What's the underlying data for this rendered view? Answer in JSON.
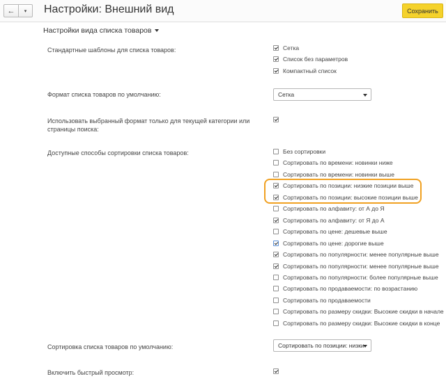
{
  "window": {
    "title": "Настройки: Внешний вид",
    "save_label": "Сохранить",
    "back_icon": "←",
    "menu_icon": "▾"
  },
  "section": {
    "title": "Настройки вида списка товаров"
  },
  "templates": {
    "label": "Стандартные шаблоны для списка товаров:",
    "options": [
      {
        "label": "Сетка",
        "checked": true
      },
      {
        "label": "Список без параметров",
        "checked": true
      },
      {
        "label": "Компактный список",
        "checked": true
      }
    ]
  },
  "default_format": {
    "label": "Формат списка товаров по умолчанию:",
    "value": "Сетка"
  },
  "current_only": {
    "label": "Использовать выбранный формат только для текущей категории или страницы поиска:",
    "checked": true
  },
  "sorting": {
    "label": "Доступные способы сортировки списка товаров:",
    "options": [
      {
        "label": "Без сортировки",
        "checked": false
      },
      {
        "label": "Сортировать по времени: новинки ниже",
        "checked": false
      },
      {
        "label": "Сортировать по времени: новинки выше",
        "checked": false
      },
      {
        "label": "Сортировать по позиции: низкие позиции выше",
        "checked": true
      },
      {
        "label": "Сортировать по позиции: высокие позиции выше",
        "checked": true
      },
      {
        "label": "Сортировать по алфавиту: от А до Я",
        "checked": false
      },
      {
        "label": "Сортировать по алфавиту: от Я до А",
        "checked": true
      },
      {
        "label": "Сортировать по цене: дешевые выше",
        "checked": false
      },
      {
        "label": "Сортировать по цене: дорогие выше",
        "checked": true
      },
      {
        "label": "Сортировать по популярности: менее популярные выше",
        "checked": true
      },
      {
        "label": "Сортировать по популярности: менее популярные выше",
        "checked": true
      },
      {
        "label": "Сортировать по популярности: более популярные выше",
        "checked": false
      },
      {
        "label": "Сортировать по продаваемости: по возрастанию",
        "checked": false
      },
      {
        "label": "Сортировать по продаваемости",
        "checked": false
      },
      {
        "label": "Сортировать по размеру скидки: Высокие скидки в начале",
        "checked": false
      },
      {
        "label": "Сортировать по размеру скидки: Высокие скидки в конце",
        "checked": false
      }
    ]
  },
  "default_sort": {
    "label": "Сортировка списка товаров по умолчанию:",
    "value": "Сортировать по позиции: низки"
  },
  "quick_view": {
    "label": "Включить быстрый просмотр:",
    "checked": true
  },
  "colors": {
    "accent": "#f5d22b",
    "highlight": "#f0a020"
  }
}
